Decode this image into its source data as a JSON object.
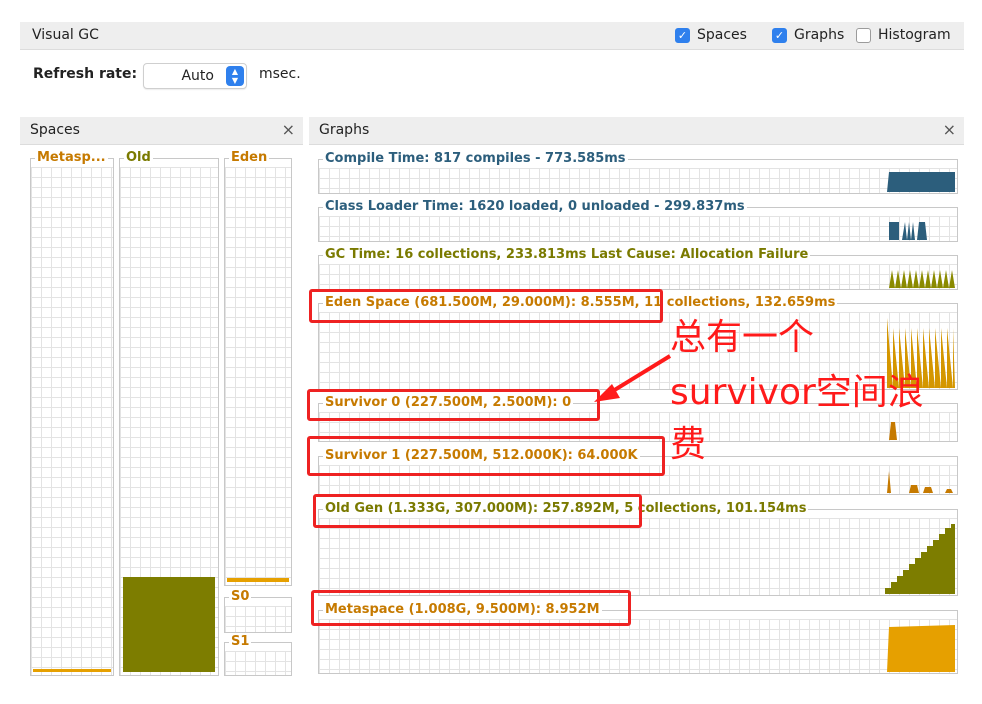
{
  "window": {
    "title": "Visual GC",
    "checkboxes": [
      {
        "label": "Spaces",
        "checked": true
      },
      {
        "label": "Graphs",
        "checked": true
      },
      {
        "label": "Histogram",
        "checked": false
      }
    ]
  },
  "refresh": {
    "label": "Refresh rate:",
    "value": "Auto",
    "unit": "msec."
  },
  "spaces_panel": {
    "title": "Spaces",
    "close": "×",
    "labels": {
      "metaspace": "Metasp...",
      "old": "Old",
      "eden": "Eden",
      "s0": "S0",
      "s1": "S1"
    }
  },
  "graphs_panel": {
    "title": "Graphs",
    "close": "×",
    "graphs": [
      {
        "key": "compile",
        "label": "Compile Time: 817 compiles - 773.585ms"
      },
      {
        "key": "classloader",
        "label": "Class Loader Time: 1620 loaded, 0 unloaded - 299.837ms"
      },
      {
        "key": "gc",
        "label": "GC Time: 16 collections, 233.813ms Last Cause: Allocation Failure"
      },
      {
        "key": "eden",
        "label": "Eden Space (681.500M, 29.000M): 8.555M, 11 collections, 132.659ms"
      },
      {
        "key": "survivor0",
        "label": "Survivor 0 (227.500M, 2.500M): 0"
      },
      {
        "key": "survivor1",
        "label": "Survivor 1 (227.500M, 512.000K): 64.000K"
      },
      {
        "key": "oldgen",
        "label": "Old Gen (1.333G, 307.000M): 257.892M, 5 collections, 101.154ms"
      },
      {
        "key": "metaspace",
        "label": "Metaspace (1.008G, 9.500M): 8.952M"
      }
    ]
  },
  "annotation": {
    "lines": [
      "总有一个",
      "survivor空间浪",
      "费"
    ]
  },
  "colors": {
    "blue_series": "#2c5e7c",
    "olive_series": "#7a7a00",
    "orange_series": "#e6a000",
    "annotation_red": "#ee2222",
    "checkbox_blue": "#2f80ed"
  }
}
